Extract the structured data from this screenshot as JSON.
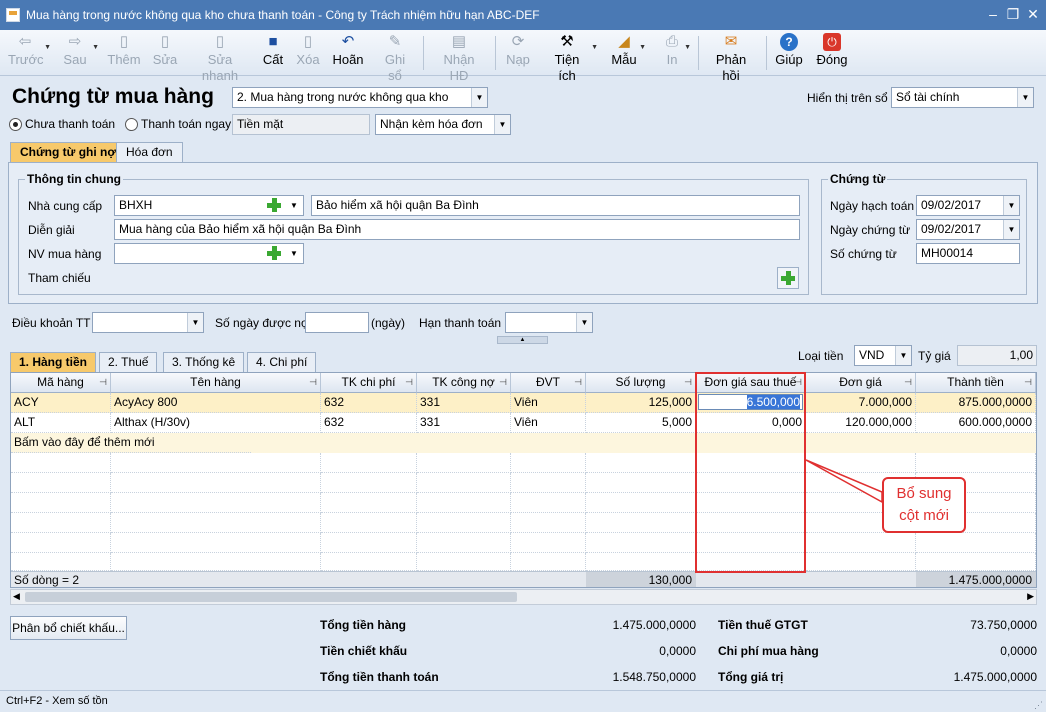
{
  "window": {
    "title": "Mua hàng trong nước không qua kho chưa thanh toán - Công ty Trách nhiệm hữu hạn ABC-DEF",
    "controls": [
      "–",
      "❐",
      "✕"
    ]
  },
  "toolbar": {
    "buttons": [
      {
        "label": "Trước",
        "icon": "arrow-left-icon",
        "glyph": "⇦"
      },
      {
        "label": "Sau",
        "icon": "arrow-right-icon",
        "glyph": "⇨"
      },
      {
        "label": "Thêm",
        "icon": "add-document-icon",
        "glyph": "▯"
      },
      {
        "label": "Sửa",
        "icon": "edit-document-icon",
        "glyph": "▯"
      },
      {
        "label": "Sửa nhanh",
        "icon": "quick-edit-icon",
        "glyph": "▯"
      },
      {
        "label": "Cất",
        "icon": "save-icon",
        "glyph": "■"
      },
      {
        "label": "Xóa",
        "icon": "delete-icon",
        "glyph": "▯"
      },
      {
        "label": "Hoãn",
        "icon": "undo-icon",
        "glyph": "↶"
      },
      {
        "label": "Ghi sổ",
        "icon": "pencil-icon",
        "glyph": "✎"
      },
      {
        "label": "Nhận HĐ",
        "icon": "receive-invoice-icon",
        "glyph": "▤"
      },
      {
        "label": "Nạp",
        "icon": "reload-icon",
        "glyph": "⟳"
      },
      {
        "label": "Tiện ích",
        "icon": "tools-icon",
        "glyph": "⚒"
      },
      {
        "label": "Mẫu",
        "icon": "template-icon",
        "glyph": "◢"
      },
      {
        "label": "In",
        "icon": "print-icon",
        "glyph": "⎙"
      },
      {
        "label": "Phản hồi",
        "icon": "feedback-mail-icon",
        "glyph": "✉"
      },
      {
        "label": "Giúp",
        "icon": "help-icon",
        "glyph": "?"
      },
      {
        "label": "Đóng",
        "icon": "close-icon",
        "glyph": "⏻"
      }
    ]
  },
  "header": {
    "title": "Chứng từ mua hàng",
    "voucher_type": "2. Mua hàng trong nước không qua kho",
    "display_book_label": "Hiển thị trên sổ",
    "display_book_value": "Sổ tài chính",
    "radio_unpaid": "Chưa thanh toán",
    "radio_paid": "Thanh toán ngay",
    "payment_method": "Tiền mặt",
    "invoice_option": "Nhận kèm hóa đơn"
  },
  "tabs": {
    "voucher": "Chứng từ ghi nợ",
    "invoice": "Hóa đơn"
  },
  "general_info": {
    "group_title": "Thông tin chung",
    "supplier_label": "Nhà cung cấp",
    "supplier_code": "BHXH",
    "supplier_name": "Bảo hiểm xã hội quận Ba Đình",
    "description_label": "Diễn giải",
    "description": "Mua hàng của Bảo hiểm xã hội quận Ba Đình",
    "buyer_label": "NV mua hàng",
    "buyer": "",
    "reference_label": "Tham chiếu"
  },
  "voucher_info": {
    "group_title": "Chứng từ",
    "posting_date_label": "Ngày hạch toán",
    "posting_date": "09/02/2017",
    "voucher_date_label": "Ngày chứng từ",
    "voucher_date": "09/02/2017",
    "voucher_no_label": "Số chứng từ",
    "voucher_no": "MH00014"
  },
  "payment_terms": {
    "terms_label": "Điều khoản TT",
    "days_label": "Số ngày được nợ",
    "days_unit": "(ngày)",
    "due_label": "Hạn thanh toán"
  },
  "grid_tabs": [
    "1. Hàng tiền",
    "2. Thuế",
    "3. Thống kê",
    "4. Chi phí"
  ],
  "currency": {
    "label": "Loại tiền",
    "value": "VND",
    "rate_label": "Tỷ giá",
    "rate": "1,00"
  },
  "grid": {
    "columns": [
      "Mã hàng",
      "Tên hàng",
      "TK chi phí",
      "TK công nợ",
      "ĐVT",
      "Số lượng",
      "Đơn giá sau thuế",
      "Đơn giá",
      "Thành tiền"
    ],
    "rows": [
      [
        "ACY",
        "AcyAcy 800",
        "632",
        "331",
        "Viên",
        "125,000",
        "6.500,000",
        "7.000,000",
        "875.000,0000"
      ],
      [
        "ALT",
        "Althax (H/30v)",
        "632",
        "331",
        "Viên",
        "5,000",
        "0,000",
        "120.000,000",
        "600.000,0000"
      ]
    ],
    "add_row_text": "Bấm vào đây để thêm mới",
    "row_count": "Số dòng = 2",
    "total_quantity": "130,000",
    "total_amount": "1.475.000,0000"
  },
  "discount_button": "Phân bổ chiết khấu...",
  "totals": {
    "goods_label": "Tổng tiền hàng",
    "goods": "1.475.000,0000",
    "discount_label": "Tiền chiết khấu",
    "discount": "0,0000",
    "payment_label": "Tổng tiền thanh toán",
    "payment": "1.548.750,0000",
    "vat_label": "Tiền thuế GTGT",
    "vat": "73.750,0000",
    "purchase_cost_label": "Chi phí mua hàng",
    "purchase_cost": "0,0000",
    "value_label": "Tổng giá trị",
    "value": "1.475.000,0000"
  },
  "status": "Ctrl+F2 - Xem số tồn",
  "annotation": {
    "line1": "Bổ sung",
    "line2": "cột mới",
    "color": "#e03030"
  }
}
